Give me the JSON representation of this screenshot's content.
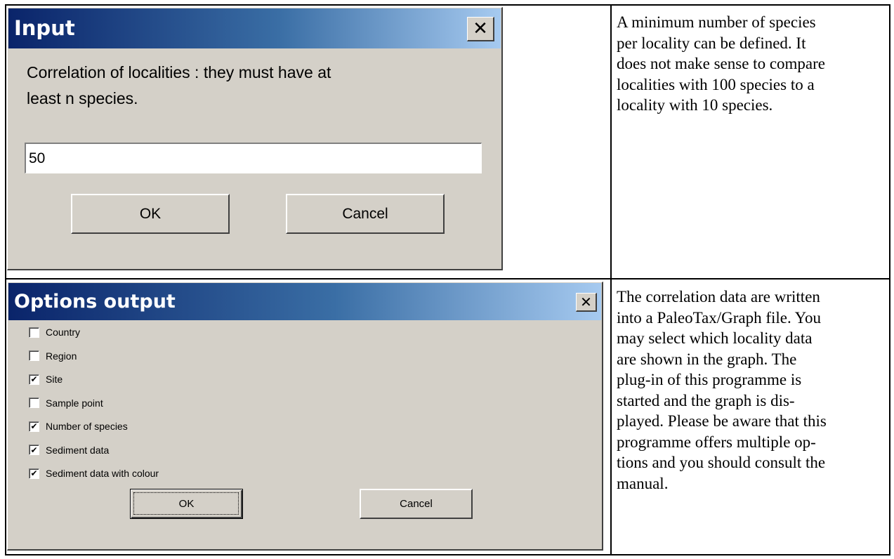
{
  "input_dialog": {
    "title": "Input",
    "close_label": "✕",
    "prompt_lines": [
      "Correlation of localities : they must have at",
      "least n species."
    ],
    "value": "50",
    "ok_label": "OK",
    "cancel_label": "Cancel"
  },
  "input_description": {
    "lines": [
      "A minimum number of species",
      "per locality can be defined. It",
      "does not make sense to compare",
      "localities with 100 species to a",
      "locality with 10 species."
    ]
  },
  "options_dialog": {
    "title": "Options output",
    "close_label": "✕",
    "options": [
      {
        "label": "Country",
        "checked": false
      },
      {
        "label": "Region",
        "checked": false
      },
      {
        "label": "Site",
        "checked": true
      },
      {
        "label": "Sample point",
        "checked": false
      },
      {
        "label": "Number of species",
        "checked": true
      },
      {
        "label": "Sediment data",
        "checked": true
      },
      {
        "label": "Sediment data with colour",
        "checked": true
      }
    ],
    "ok_label": "OK",
    "cancel_label": "Cancel"
  },
  "options_description": {
    "lines": [
      "The correlation data are written",
      "into a PaleoTax/Graph file. You",
      "may select which locality data",
      "are shown in the graph. The",
      "plug-in of this programme is",
      "started and the graph is dis-",
      "played. Please be aware that this",
      "programme offers multiple op-",
      "tions and you should consult the",
      "manual."
    ]
  }
}
